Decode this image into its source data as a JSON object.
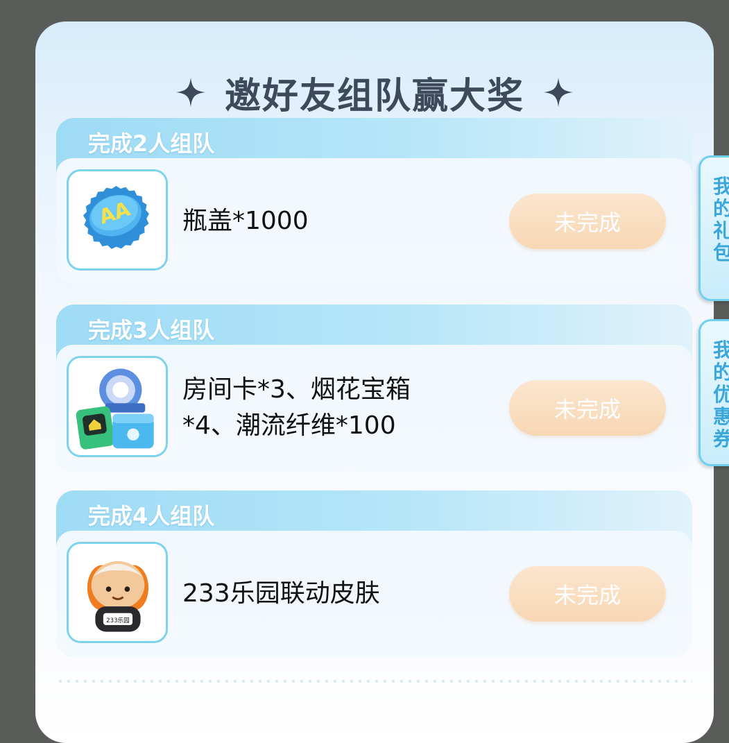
{
  "header": {
    "title": "邀好友组队赢大奖"
  },
  "tasks": [
    {
      "heading": "完成2人组队",
      "reward": "瓶盖*1000",
      "icon": "bottle-cap-icon",
      "status": "未完成"
    },
    {
      "heading": "完成3人组队",
      "reward": "房间卡*3、烟花宝箱*4、潮流纤维*100",
      "icon": "gift-bundle-icon",
      "status": "未完成"
    },
    {
      "heading": "完成4人组队",
      "reward": "233乐园联动皮肤",
      "icon": "mascot-skin-icon",
      "status": "未完成"
    }
  ],
  "side_tabs": {
    "gifts": "我的礼包",
    "coupons": "我的优惠券"
  },
  "mascot_badge": "233乐园",
  "colors": {
    "accent": "#7dd2ec",
    "button": "#f7d7b4",
    "title": "#3c4a5c"
  }
}
